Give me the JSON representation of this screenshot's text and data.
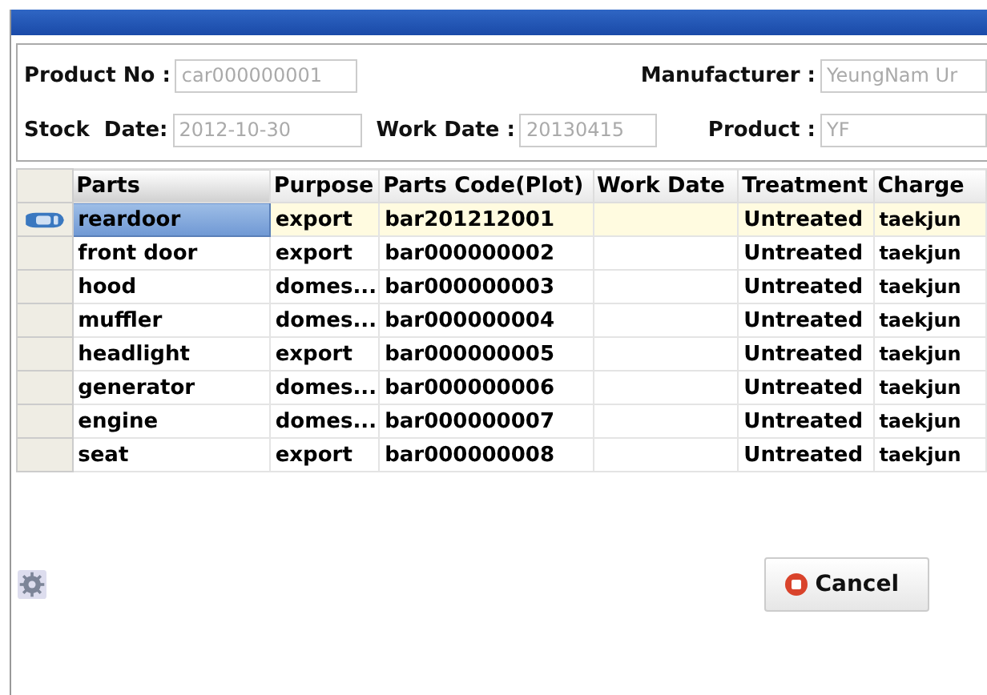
{
  "form": {
    "product_no": {
      "label": "Product No :",
      "value": "car000000001"
    },
    "manufacturer": {
      "label": "Manufacturer :",
      "value": "YeungNam Ur"
    },
    "stock_date": {
      "label": "Stock  Date:",
      "value": "2012-10-30"
    },
    "work_date": {
      "label": "Work Date :",
      "value": "20130415"
    },
    "product": {
      "label": "Product :",
      "value": "YF"
    }
  },
  "table": {
    "columns": [
      "Parts",
      "Purpose",
      "Parts Code(Plot)",
      "Work Date",
      "Treatment",
      "Charge"
    ],
    "rows": [
      {
        "selected": true,
        "cells": [
          "reardoor",
          "export",
          "bar201212001",
          "",
          "Untreated",
          "taekjun"
        ]
      },
      {
        "selected": false,
        "cells": [
          "front door",
          "export",
          "bar000000002",
          "",
          "Untreated",
          "taekjun"
        ]
      },
      {
        "selected": false,
        "cells": [
          "hood",
          "domes...",
          "bar000000003",
          "",
          "Untreated",
          "taekjun"
        ]
      },
      {
        "selected": false,
        "cells": [
          "muffler",
          "domes...",
          "bar000000004",
          "",
          "Untreated",
          "taekjun"
        ]
      },
      {
        "selected": false,
        "cells": [
          "headlight",
          "export",
          "bar000000005",
          "",
          "Untreated",
          "taekjun"
        ]
      },
      {
        "selected": false,
        "cells": [
          "generator",
          "domes...",
          "bar000000006",
          "",
          "Untreated",
          "taekjun"
        ]
      },
      {
        "selected": false,
        "cells": [
          "engine",
          "domes...",
          "bar000000007",
          "",
          "Untreated",
          "taekjun"
        ]
      },
      {
        "selected": false,
        "cells": [
          "seat",
          "export",
          "bar000000008",
          "",
          "Untreated",
          "taekjun"
        ]
      }
    ]
  },
  "buttons": [
    {
      "label": "Cancel"
    }
  ]
}
